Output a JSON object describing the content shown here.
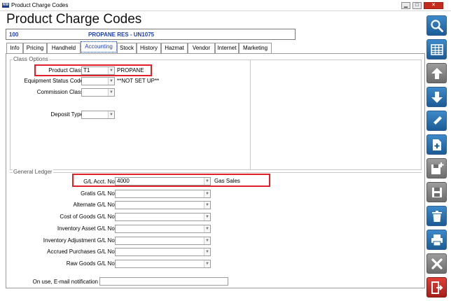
{
  "window": {
    "title": "Product Charge Codes",
    "app_icon_text": "NW"
  },
  "page": {
    "title": "Product Charge Codes"
  },
  "product": {
    "code": "100",
    "description": "PROPANE RES - UN1075"
  },
  "tabs": [
    "Info",
    "Pricing",
    "Handheld",
    "Accounting",
    "Stock",
    "History",
    "Hazmat",
    "Vendor",
    "Internet",
    "Marketing"
  ],
  "active_tab": "Accounting",
  "class_options": {
    "title": "Class Options",
    "product_class_label": "Product Class",
    "product_class_value": "T1",
    "product_class_desc": "PROPANE",
    "equipment_status_label": "Equipment Status Code",
    "equipment_status_value": "",
    "equipment_status_desc": "**NOT SET UP**",
    "commission_class_label": "Commission Class",
    "commission_class_value": "",
    "deposit_type_label": "Deposit Type",
    "deposit_type_value": ""
  },
  "general_ledger": {
    "title": "General Ledger",
    "gl_acct_label": "G/L Acct. No.",
    "gl_acct_value": "4000",
    "gl_acct_desc": "Gas Sales",
    "gratis_label": "Gratis G/L No.",
    "alternate_label": "Alternate G/L No.",
    "cost_of_goods_label": "Cost of Goods G/L No.",
    "inventory_asset_label": "Inventory Asset G/L No.",
    "inventory_adjustment_label": "Inventory Adjustment G/L No.",
    "accrued_purchases_label": "Accrued Purchases G/L No.",
    "raw_goods_label": "Raw Goods G/L No."
  },
  "email_notification": {
    "label": "On use, E-mail notification",
    "value": ""
  },
  "colors": {
    "accent_blue": "#1c3fb0",
    "highlight_red": "#e2202a",
    "button_blue": "#2a72b3",
    "button_grey": "#7e7e7e",
    "button_red": "#c2302a"
  },
  "sidebar_icons": [
    "search-icon",
    "grid-icon",
    "arrow-up-icon",
    "arrow-down-icon",
    "pencil-icon",
    "new-document-icon",
    "add-save-icon",
    "save-icon",
    "delete-icon",
    "print-icon",
    "cancel-icon",
    "exit-icon"
  ]
}
